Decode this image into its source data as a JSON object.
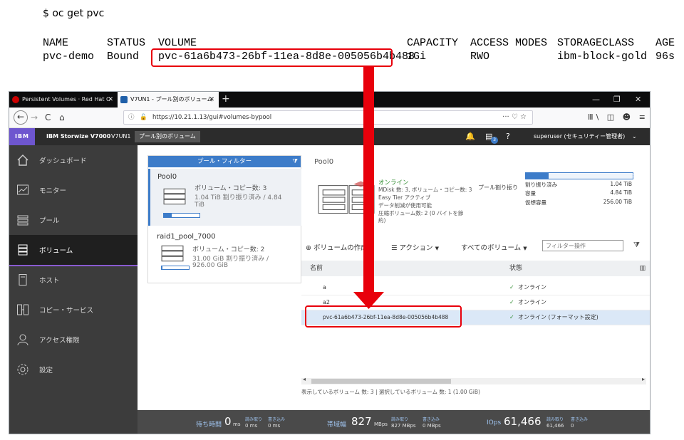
{
  "terminal": {
    "command": "$ oc get pvc",
    "headers": [
      "NAME",
      "STATUS",
      "VOLUME",
      "CAPACITY",
      "ACCESS MODES",
      "STORAGECLASS",
      "AGE"
    ],
    "row": [
      "pvc-demo",
      "Bound",
      "pvc-61a6b473-26bf-11ea-8d8e-005056b4b488",
      "1Gi",
      "RWO",
      "ibm-block-gold",
      "96s"
    ]
  },
  "browser": {
    "tabs": [
      {
        "label": "Persistent Volumes · Red Hat O",
        "active": false
      },
      {
        "label": "V7UN1 - プール別のボリューム",
        "active": true
      }
    ],
    "url": "https://10.21.1.13/gui#volumes-bypool",
    "nav": {
      "back": "←",
      "forward": "→",
      "reload": "C",
      "home": "⌂"
    },
    "url_actions": "··· ♡ ☆",
    "toolbar_icons": "Ⅲ\\ ◫ ☻ ≡"
  },
  "app": {
    "brand": "IBM",
    "product": "IBM Storwize V7000",
    "system": "V7UN1",
    "page": "プール別のボリューム",
    "user": "superuser (セキュリティー管理者)",
    "badge": "3"
  },
  "sidebar": {
    "items": [
      {
        "label": "ダッシュボード",
        "icon": "home-icon"
      },
      {
        "label": "モニター",
        "icon": "monitor-icon"
      },
      {
        "label": "プール",
        "icon": "pools-icon"
      },
      {
        "label": "ボリューム",
        "icon": "volumes-icon",
        "active": true
      },
      {
        "label": "ホスト",
        "icon": "hosts-icon"
      },
      {
        "label": "コピー・サービス",
        "icon": "copy-services-icon"
      },
      {
        "label": "アクセス権限",
        "icon": "access-icon"
      },
      {
        "label": "設定",
        "icon": "settings-icon"
      }
    ]
  },
  "filter": {
    "title": "プール・フィルター",
    "pools": [
      {
        "name": "Pool0",
        "line1": "ボリューム・コピー数: 3",
        "line2": "1.04 TiB 割り振り済み / 4.84",
        "line3": "TiB",
        "fill": 0.21
      },
      {
        "name": "raid1_pool_7000",
        "line1": "ボリューム・コピー数: 2",
        "line2": "31.00 GiB 割り振り済み /",
        "line3": "926.00 GiB",
        "fill": 0.03
      }
    ]
  },
  "detail": {
    "pool_name": "Pool0",
    "status": "オンライン",
    "info1": "MDisk 数: 3, ボリューム・コピー数: 3",
    "info2": "Easy Tier アクティブ",
    "info3": "データ削減が使用可能",
    "info4": "圧縮ボリューム数: 2 (0 バイトを節",
    "info5": "約)",
    "alloc_label": "プール割り振り",
    "alloc_fill": 0.21,
    "stats": [
      {
        "label": "割り振り済み",
        "value": "1.04 TiB"
      },
      {
        "label": "容量",
        "value": "4.84 TiB"
      },
      {
        "label": "仮想容量",
        "value": "256.00 TiB"
      }
    ]
  },
  "toolbar": {
    "create": "⊕ ボリュームの作成",
    "actions": "☰ アクション",
    "all_volumes": "すべてのボリューム",
    "filter_placeholder": "フィルター操作"
  },
  "grid": {
    "col_name": "名前",
    "col_state": "状態",
    "rows": [
      {
        "name": "a",
        "state": "オンライン",
        "selected": false
      },
      {
        "name": "a2",
        "state": "オンライン",
        "selected": false
      },
      {
        "name": "pvc-61a6b473-26bf-11ea-8d8e-005056b4b488",
        "state": "オンライン (フォーマット設定)",
        "selected": true
      }
    ],
    "footer": "表示しているボリューム 数: 3 | 選択しているボリューム 数: 1 (1.00 GiB)"
  },
  "status": {
    "latency_label": "待ち時間",
    "latency_value": "0",
    "latency_unit": "ms",
    "lat_read_label": "読み取り",
    "lat_read": "0 ms",
    "lat_write_label": "書き込み",
    "lat_write": "0 ms",
    "bw_label": "帯域幅",
    "bw_value": "827",
    "bw_unit": "MBps",
    "bw_read_label": "読み取り",
    "bw_read": "827 MBps",
    "bw_write_label": "書き込み",
    "bw_write": "0 MBps",
    "iops_label": "IOps",
    "iops_value": "61,466",
    "iops_read_label": "読み取り",
    "iops_read": "61,466",
    "iops_write_label": "書き込み",
    "iops_write": "0"
  },
  "colors": {
    "highlight": "#e8000b",
    "accent": "#3d7cc9",
    "purple": "#8a5bd1"
  }
}
